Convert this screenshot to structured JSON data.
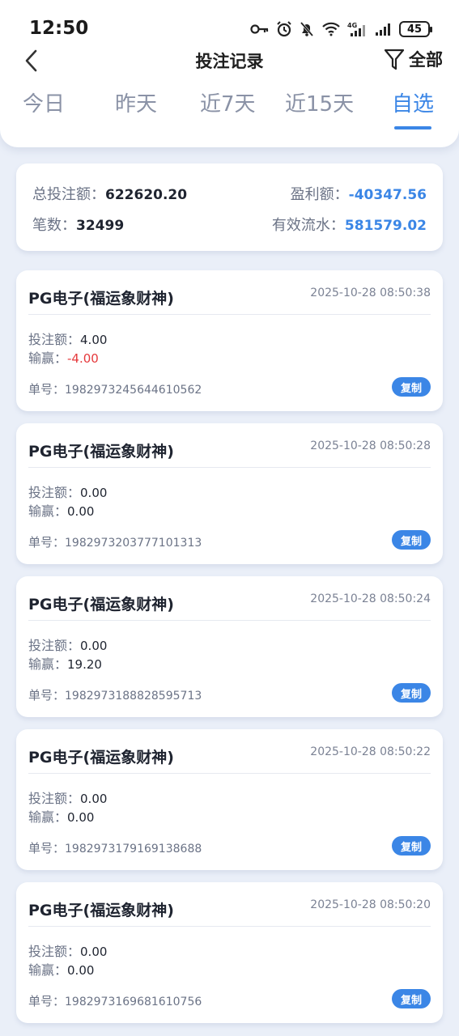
{
  "status_bar": {
    "time": "12:50",
    "battery": "45"
  },
  "header": {
    "title": "投注记录",
    "filter_label": "全部"
  },
  "tabs": [
    {
      "label": "今日"
    },
    {
      "label": "昨天"
    },
    {
      "label": "近7天"
    },
    {
      "label": "近15天"
    },
    {
      "label": "自选"
    }
  ],
  "active_tab": "自选",
  "summary": {
    "total_bet_label": "总投注额：",
    "total_bet": "622620.20",
    "profit_label": "盈利额：",
    "profit": "-40347.56",
    "count_label": "笔数：",
    "count": "32499",
    "turnover_label": "有效流水：",
    "turnover": "581579.02"
  },
  "labels": {
    "bet": "投注额：",
    "win": "输赢：",
    "order": "单号：",
    "copy": "复制"
  },
  "records": [
    {
      "game": "PG电子(福运象财神)",
      "time": "2025-10-28 08:50:38",
      "bet": "4.00",
      "win": "-4.00",
      "order": "1982973245644610562"
    },
    {
      "game": "PG电子(福运象财神)",
      "time": "2025-10-28 08:50:28",
      "bet": "0.00",
      "win": "0.00",
      "order": "1982973203777101313"
    },
    {
      "game": "PG电子(福运象财神)",
      "time": "2025-10-28 08:50:24",
      "bet": "0.00",
      "win": "19.20",
      "order": "1982973188828595713"
    },
    {
      "game": "PG电子(福运象财神)",
      "time": "2025-10-28 08:50:22",
      "bet": "0.00",
      "win": "0.00",
      "order": "1982973179169138688"
    },
    {
      "game": "PG电子(福运象财神)",
      "time": "2025-10-28 08:50:20",
      "bet": "0.00",
      "win": "0.00",
      "order": "1982973169681610756"
    }
  ],
  "colors": {
    "accent": "#3b86e6",
    "negative": "#e5393c",
    "background": "#eaeff8"
  }
}
